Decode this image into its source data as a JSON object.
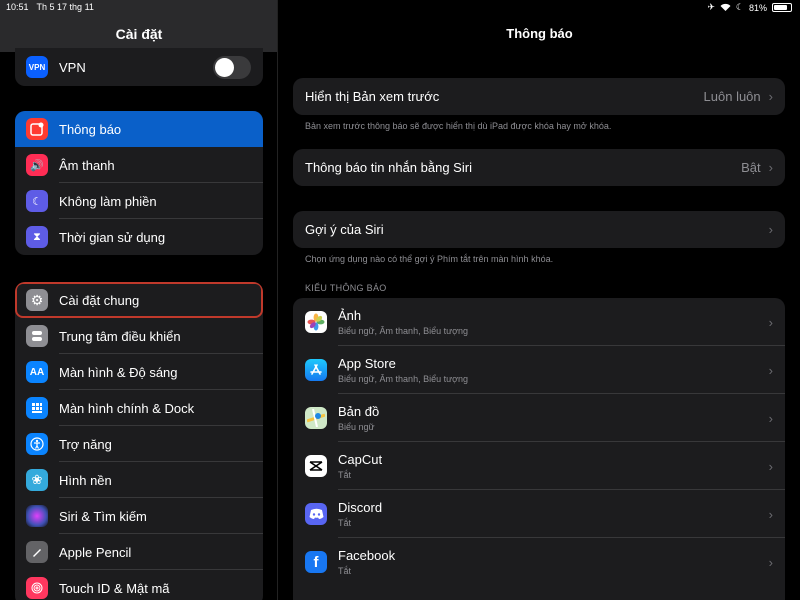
{
  "status": {
    "time": "10:51",
    "date": "Th 5 17 thg 11",
    "battery": "81%",
    "battery_level": 0.81
  },
  "sidebar": {
    "title": "Cài đặt",
    "vpn": {
      "label": "VPN",
      "enabled": false
    },
    "group1": [
      {
        "label": "Thông báo",
        "icon": "notifications-icon",
        "color": "#ff3b30"
      },
      {
        "label": "Âm thanh",
        "icon": "sound-icon",
        "color": "#ff2d55"
      },
      {
        "label": "Không làm phiền",
        "icon": "moon-icon",
        "color": "#5e5ce6"
      },
      {
        "label": "Thời gian sử dụng",
        "icon": "hourglass-icon",
        "color": "#5e5ce6"
      }
    ],
    "group2": [
      {
        "label": "Cài đặt chung",
        "icon": "gear-icon",
        "color": "#8e8e93"
      },
      {
        "label": "Trung tâm điều khiển",
        "icon": "control-center-icon",
        "color": "#8e8e93"
      },
      {
        "label": "Màn hình & Độ sáng",
        "icon": "display-icon",
        "color": "#0a84ff"
      },
      {
        "label": "Màn hình chính & Dock",
        "icon": "home-screen-icon",
        "color": "#0a84ff"
      },
      {
        "label": "Trợ năng",
        "icon": "accessibility-icon",
        "color": "#0a84ff"
      },
      {
        "label": "Hình nền",
        "icon": "wallpaper-icon",
        "color": "#34aadc"
      },
      {
        "label": "Siri & Tìm kiếm",
        "icon": "siri-icon",
        "color": "#333"
      },
      {
        "label": "Apple Pencil",
        "icon": "pencil-icon",
        "color": "#636366"
      },
      {
        "label": "Touch ID & Mật mã",
        "icon": "fingerprint-icon",
        "color": "#ff375f"
      }
    ]
  },
  "main": {
    "title": "Thông báo",
    "preview": {
      "label": "Hiển thị Bản xem trước",
      "value": "Luôn luôn",
      "footnote": "Bản xem trước thông báo sẽ được hiển thị dù iPad được khóa hay mở khóa."
    },
    "siri_announce": {
      "label": "Thông báo tin nhắn bằng Siri",
      "value": "Bật"
    },
    "siri_suggest": {
      "label": "Gợi ý của Siri",
      "footnote": "Chọn ứng dụng nào có thể gợi ý Phím tắt trên màn hình khóa."
    },
    "section_header": "KIỂU THÔNG BÁO",
    "apps": [
      {
        "name": "Ảnh",
        "sub": "Biểu ngữ, Âm thanh, Biểu tượng",
        "icon": "photos-icon"
      },
      {
        "name": "App Store",
        "sub": "Biểu ngữ, Âm thanh, Biểu tượng",
        "icon": "app-store-icon"
      },
      {
        "name": "Bản đồ",
        "sub": "Biểu ngữ",
        "icon": "maps-icon"
      },
      {
        "name": "CapCut",
        "sub": "Tắt",
        "icon": "capcut-icon"
      },
      {
        "name": "Discord",
        "sub": "Tắt",
        "icon": "discord-icon"
      },
      {
        "name": "Facebook",
        "sub": "Tắt",
        "icon": "facebook-icon"
      }
    ]
  }
}
